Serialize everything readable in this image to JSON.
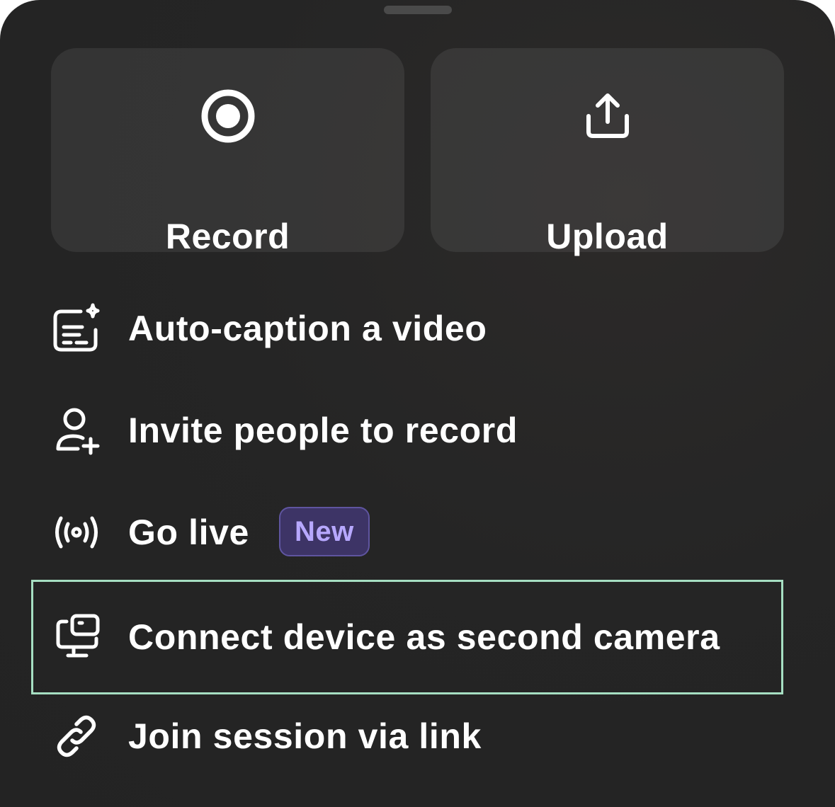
{
  "tiles": {
    "record": {
      "label": "Record",
      "icon": "record-icon"
    },
    "upload": {
      "label": "Upload",
      "icon": "upload-icon"
    }
  },
  "menu": {
    "items": [
      {
        "label": "Auto-caption a video",
        "icon": "caption-sparkle-icon"
      },
      {
        "label": "Invite people to record",
        "icon": "add-user-icon"
      },
      {
        "label": "Go live",
        "icon": "broadcast-icon",
        "badge": "New"
      },
      {
        "label": "Connect device as second camera",
        "icon": "second-camera-device-icon",
        "focused": true
      },
      {
        "label": "Join session via link",
        "icon": "link-icon"
      }
    ]
  },
  "colors": {
    "sheet_background": "#252525",
    "tile_background": "#333333",
    "text": "#ffffff",
    "badge_background": "#3d3466",
    "badge_text": "#b7a8ff",
    "focus_ring": "#a6dfc2"
  }
}
